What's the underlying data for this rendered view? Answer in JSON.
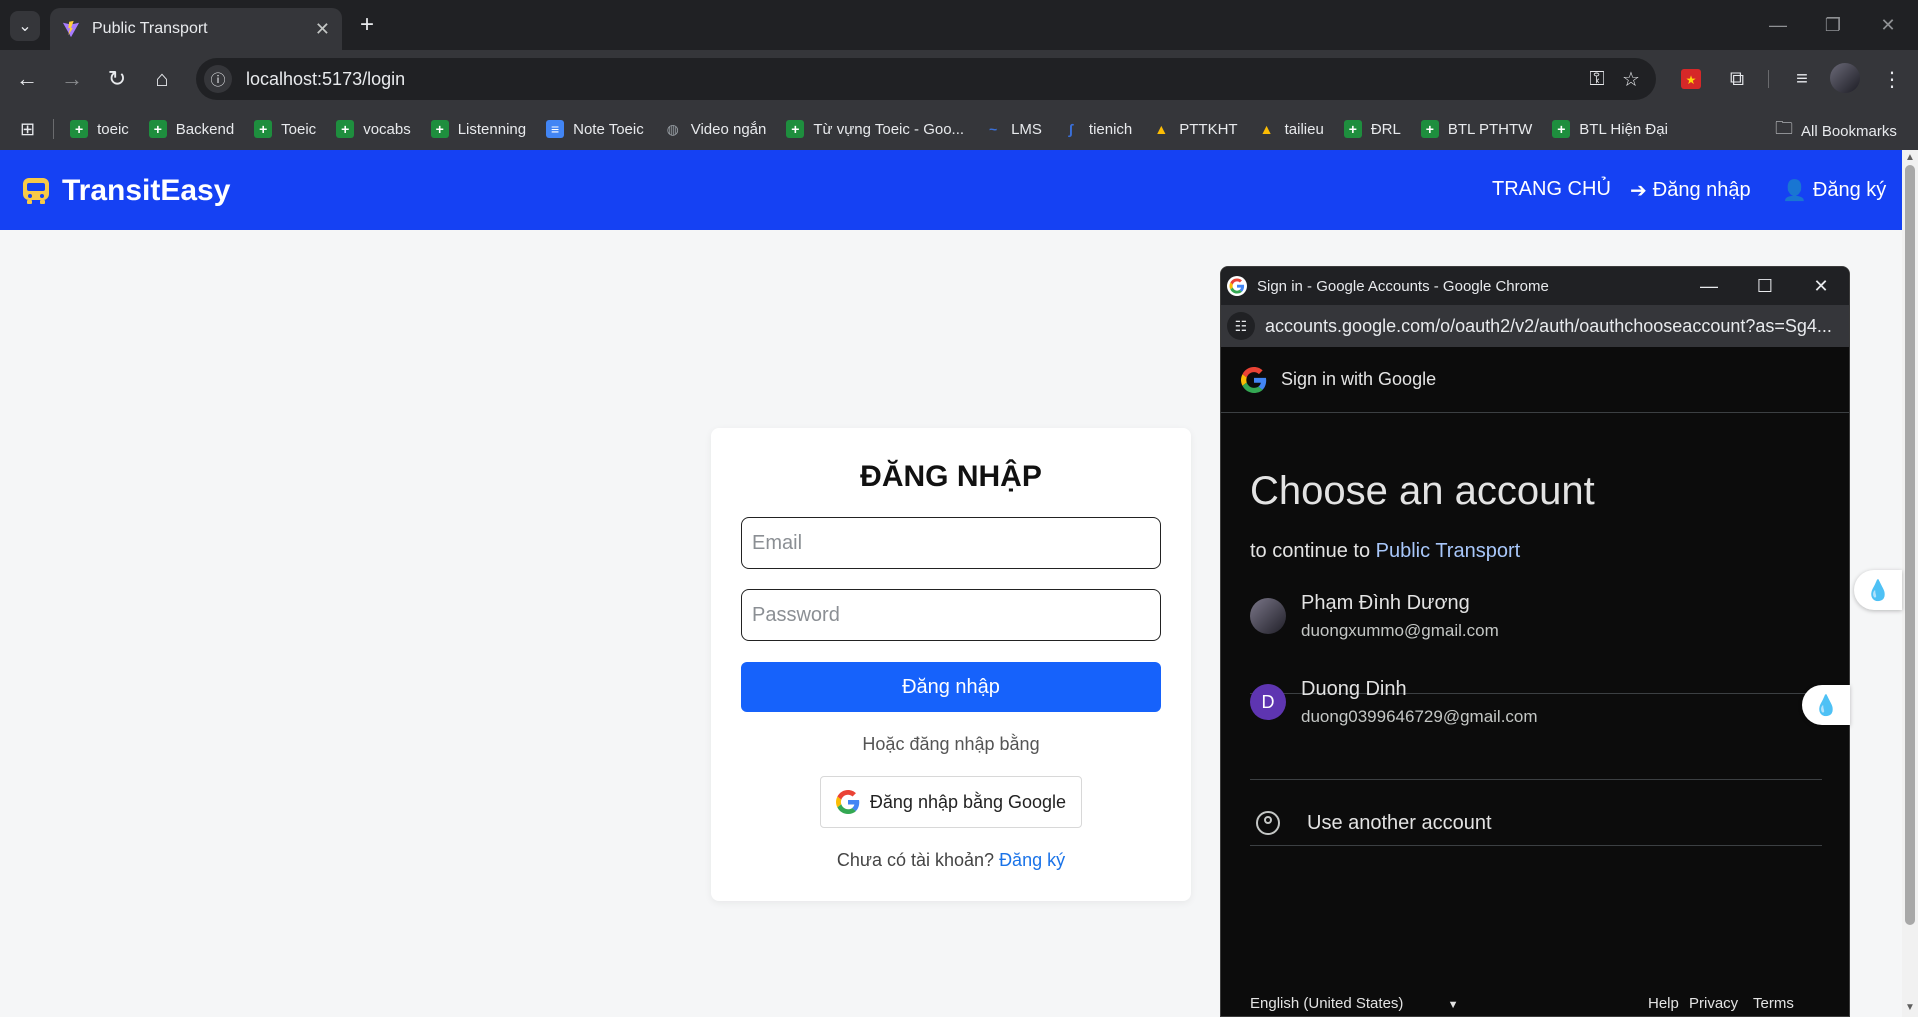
{
  "browser": {
    "tab_title": "Public Transport",
    "url": "localhost:5173/login",
    "bookmarks": [
      {
        "label": "toeic",
        "icon": "sheets-icon",
        "color": "#1e8e3e"
      },
      {
        "label": "Backend",
        "icon": "sheets-icon",
        "color": "#1e8e3e"
      },
      {
        "label": "Toeic",
        "icon": "sheets-icon",
        "color": "#1e8e3e"
      },
      {
        "label": "vocabs",
        "icon": "sheets-icon",
        "color": "#1e8e3e"
      },
      {
        "label": "Listenning",
        "icon": "sheets-icon",
        "color": "#1e8e3e"
      },
      {
        "label": "Note Toeic",
        "icon": "docs-icon",
        "color": "#4285f4"
      },
      {
        "label": "Video ngắn",
        "icon": "globe-icon",
        "color": "#9aa0a6"
      },
      {
        "label": "Từ vựng Toeic - Goo...",
        "icon": "sheets-icon",
        "color": "#1e8e3e"
      },
      {
        "label": "LMS",
        "icon": "lms-icon",
        "color": "#3a6fd8"
      },
      {
        "label": "tienich",
        "icon": "tienich-icon",
        "color": "#3a6fd8"
      },
      {
        "label": "PTTKHT",
        "icon": "drive-icon",
        "color": "#fbbc04"
      },
      {
        "label": "tailieu",
        "icon": "drive-icon",
        "color": "#fbbc04"
      },
      {
        "label": "ĐRL",
        "icon": "sheets-icon",
        "color": "#1e8e3e"
      },
      {
        "label": "BTL PTHTW",
        "icon": "sheets-icon",
        "color": "#1e8e3e"
      },
      {
        "label": "BTL Hiện Đại",
        "icon": "sheets-icon",
        "color": "#1e8e3e"
      }
    ],
    "all_bookmarks": "All Bookmarks"
  },
  "app": {
    "brand": "TransitEasy",
    "nav": {
      "home": "TRANG CHỦ",
      "login": "Đăng nhập",
      "register": "Đăng ký"
    },
    "colors": {
      "header": "#1541f3",
      "primary_button": "#1662fb",
      "bus_icon": "#f7c948"
    }
  },
  "login": {
    "title": "ĐĂNG NHẬP",
    "email_placeholder": "Email",
    "password_placeholder": "Password",
    "submit_label": "Đăng nhập",
    "or_text": "Hoặc đăng nhập bằng",
    "google_label": "Đăng nhập bằng Google",
    "no_account_text": "Chưa có tài khoản?",
    "signup_link": "Đăng ký"
  },
  "popup": {
    "window_title": "Sign in - Google Accounts - Google Chrome",
    "url": "accounts.google.com/o/oauth2/v2/auth/oauthchooseaccount?as=Sg4...",
    "header": "Sign in with Google",
    "heading": "Choose an account",
    "continue_prefix": "to continue to",
    "continue_app": "Public Transport",
    "accounts": [
      {
        "name": "Phạm Đình Dương",
        "email": "duongxummo@gmail.com",
        "avatar": "photo"
      },
      {
        "name": "Duong Dinh",
        "email": "duong0399646729@gmail.com",
        "avatar": "D",
        "avatar_color": "#5e35b1"
      }
    ],
    "use_another": "Use another account",
    "footer": {
      "language": "English (United States)",
      "help": "Help",
      "privacy": "Privacy",
      "terms": "Terms"
    }
  }
}
